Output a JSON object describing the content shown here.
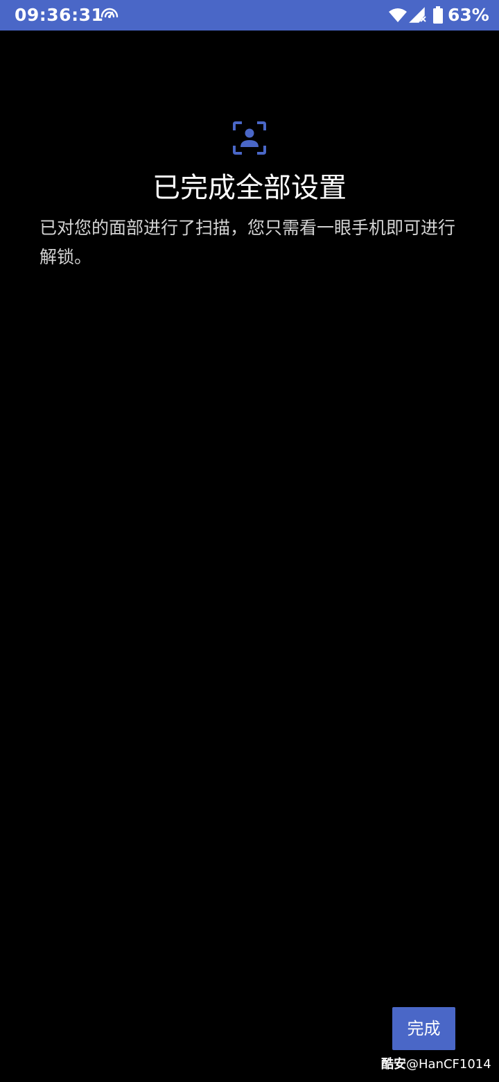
{
  "status_bar": {
    "time": "09:36:31",
    "battery_level": "63%",
    "icons": [
      "hotspot-icon",
      "wifi-icon",
      "signal-no-service-icon",
      "battery-icon"
    ],
    "background_color": "#4a67c7"
  },
  "face_icon": "face-scan-icon",
  "title": "已完成全部设置",
  "description": "已对您的面部进行了扫描，您只需看一眼手机即可进行解锁。",
  "done_button": {
    "label": "完成",
    "color": "#4a67c7"
  },
  "watermark": {
    "brand": "酷安",
    "handle": "@HanCF1014"
  }
}
